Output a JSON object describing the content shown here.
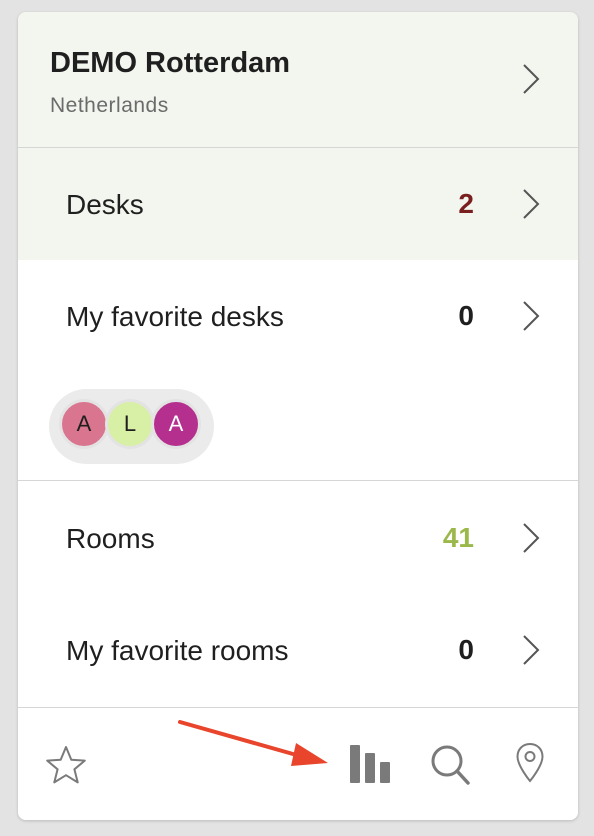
{
  "location": {
    "name": "DEMO Rotterdam",
    "country": "Netherlands"
  },
  "rows": {
    "desks": {
      "label": "Desks",
      "count": "2",
      "count_color": "#7a1f1f"
    },
    "favorite_desks": {
      "label": "My favorite desks",
      "count": "0",
      "count_color": "#1f1f1f"
    },
    "rooms": {
      "label": "Rooms",
      "count": "41",
      "count_color": "#9ab94a"
    },
    "favorite_rooms": {
      "label": "My favorite rooms",
      "count": "0",
      "count_color": "#1f1f1f"
    }
  },
  "avatars": [
    {
      "initial": "A",
      "color": "#d9758f",
      "text_color": "#1f1f1f"
    },
    {
      "initial": "L",
      "color": "#d8efa6",
      "text_color": "#1f1f1f"
    },
    {
      "initial": "A",
      "color": "#b42f8e",
      "text_color": "#ffffff"
    }
  ],
  "bottom_nav": [
    {
      "icon": "star-icon"
    },
    {
      "icon": "bar-chart-icon"
    },
    {
      "icon": "search-icon"
    },
    {
      "icon": "map-pin-icon"
    }
  ],
  "colors": {
    "highlight_bg": "#f3f6ef",
    "annotation_arrow": "#e8452c",
    "icon_gray": "#7a7a7a"
  }
}
